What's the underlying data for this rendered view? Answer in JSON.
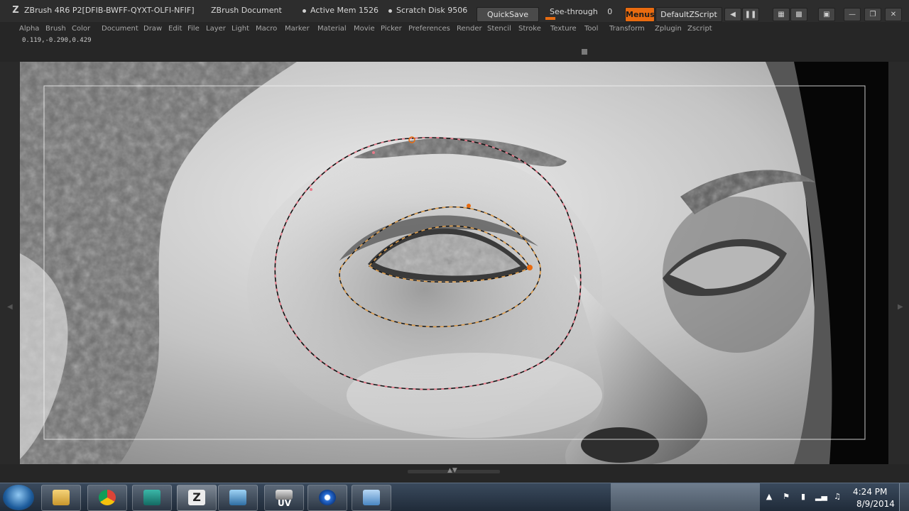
{
  "window": {
    "app_title": "ZBrush 4R6 P2[DFIB-BWFF-QYXT-OLFI-NFIF]",
    "document_title": "ZBrush Document",
    "active_mem": "Active Mem 1526",
    "scratch_disk": "Scratch Disk 9506",
    "quicksave_label": "QuickSave",
    "seethrough_label": "See-through",
    "seethrough_value": "0",
    "menus_label": "Menus",
    "script_label": "DefaultZScript"
  },
  "menubar": {
    "items": [
      "Alpha",
      "Brush",
      "Color",
      "Document",
      "Draw",
      "Edit",
      "File",
      "Layer",
      "Light",
      "Macro",
      "Marker",
      "Material",
      "Movie",
      "Picker",
      "Preferences",
      "Render",
      "Stencil",
      "Stroke",
      "Texture",
      "Tool",
      "Transform",
      "Zplugin",
      "Zscript"
    ]
  },
  "infostrip": {
    "coords": "0.119,-0.290,0.429"
  },
  "canvas": {
    "colors": {
      "sculpt_light": "#e6e6e6",
      "sculpt_mid": "#a9a9a9",
      "sculpt_dark": "#3a3a3a",
      "curve_outer_dash": "#e87a8a",
      "curve_inner_dash": "#e0a050",
      "curve_point": "#e86b10"
    }
  },
  "taskbar": {
    "apps": [
      "start",
      "explorer",
      "chrome",
      "maya",
      "zbrush",
      "photo-viewer",
      "uv-layout",
      "flower-app",
      "control-panel"
    ],
    "uv_label": "UV",
    "time": "4:24 PM",
    "date": "8/9/2014"
  },
  "icons": {
    "tray": [
      "chevron-up-icon",
      "flag-icon",
      "power-icon",
      "signal-icon",
      "volume-icon"
    ]
  }
}
